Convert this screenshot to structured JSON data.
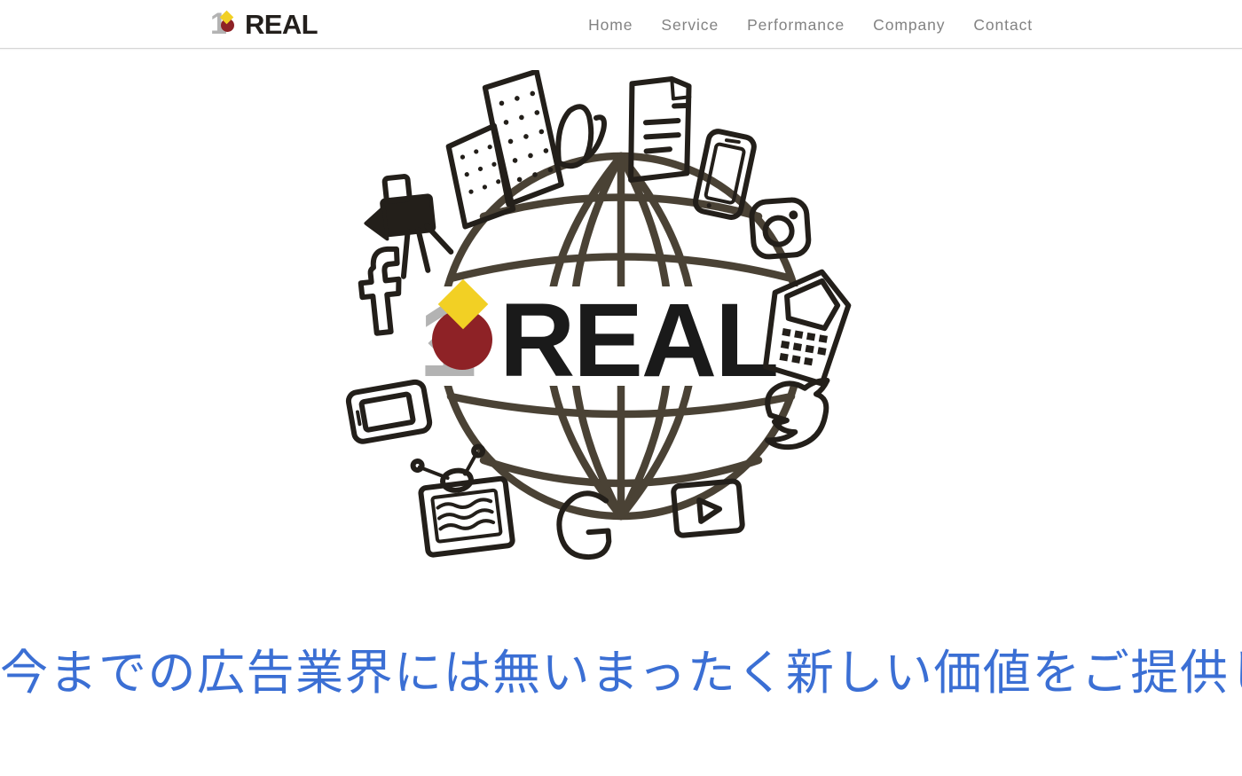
{
  "header": {
    "brand": {
      "mark_digit": "1",
      "wordmark": "REAL",
      "colors": {
        "digit": "#b3b3b3",
        "diamond": "#f2d024",
        "drop": "#8e2226",
        "word": "#231f1c"
      }
    },
    "nav": [
      {
        "label": "Home",
        "name": "nav-link-home"
      },
      {
        "label": "Service",
        "name": "nav-link-service"
      },
      {
        "label": "Performance",
        "name": "nav-link-performance"
      },
      {
        "label": "Company",
        "name": "nav-link-company"
      },
      {
        "label": "Contact",
        "name": "nav-link-contact"
      }
    ],
    "nav_color": "#828282"
  },
  "hero": {
    "art": {
      "description": "hand-drawn globe wireframe surrounded by hand-drawn media and social icons, with the 1REAL logo centered on the globe",
      "center_logo": {
        "digit": "1",
        "wordmark": "REAL"
      },
      "icons": [
        "buildings-icon",
        "shoe-icon",
        "document-icon",
        "smartphone-icon",
        "instagram-icon",
        "movie-camera-icon",
        "facebook-icon",
        "pda-phone-icon",
        "tablet-icon",
        "twitter-bird-icon",
        "retro-tv-icon",
        "g-letter-icon",
        "youtube-play-icon"
      ]
    },
    "tagline": "今までの広告業界には無いまったく新しい価値をご提供します。",
    "tagline_color": "#3b6fd4"
  }
}
